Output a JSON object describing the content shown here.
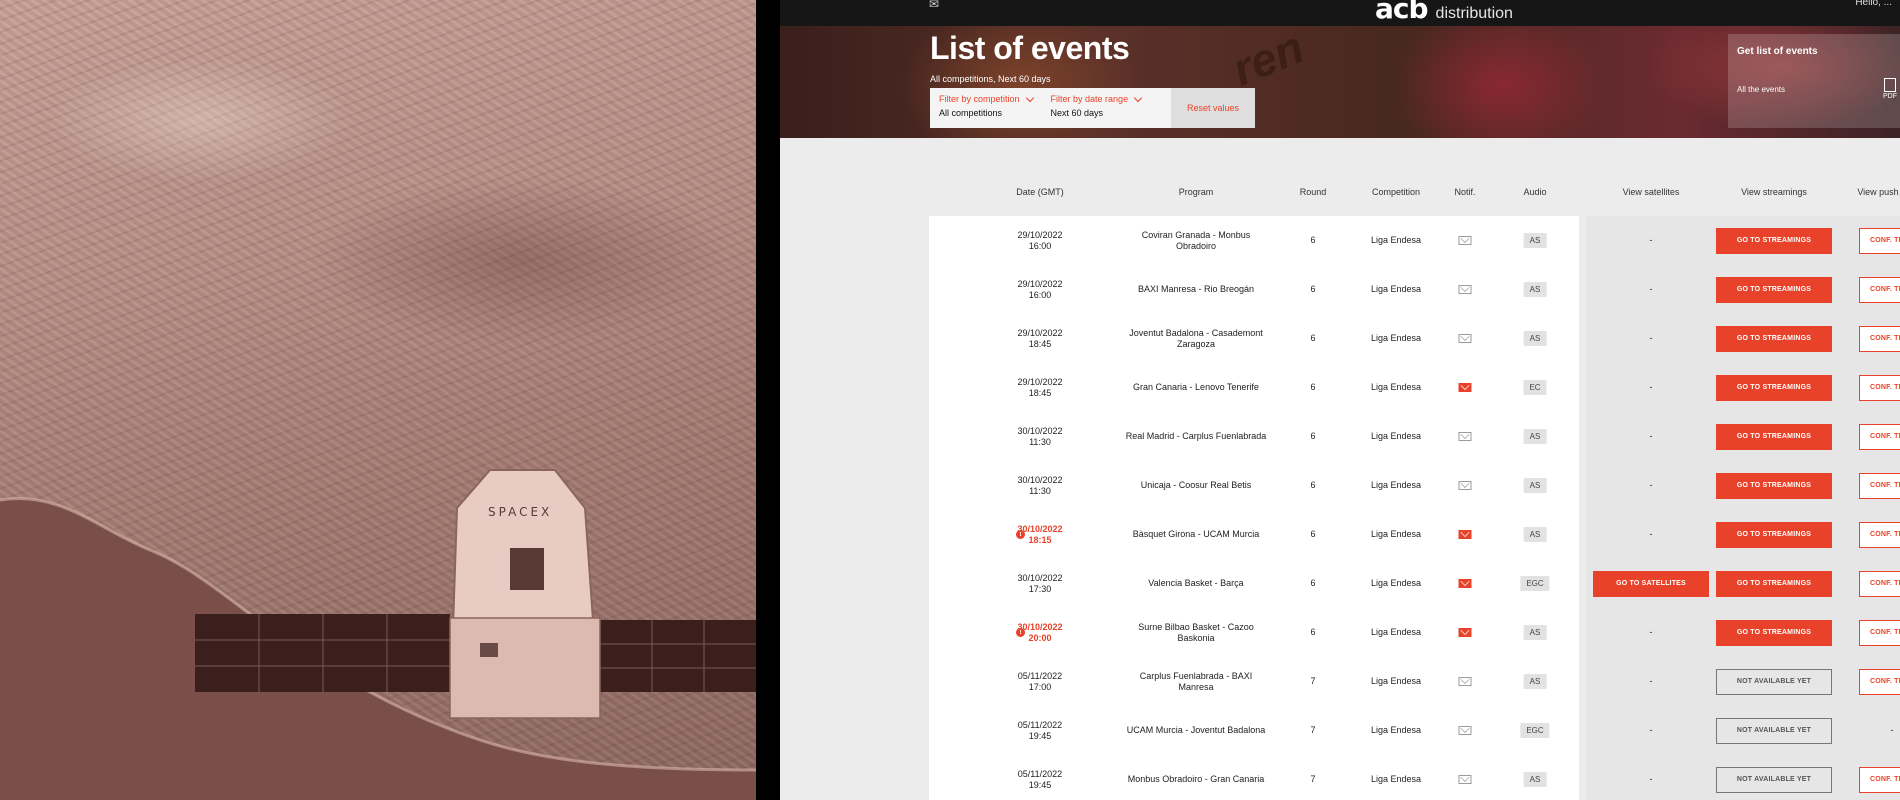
{
  "app": {
    "brand": "acb",
    "brand_sub": "distribution",
    "greeting": "Hello, ...",
    "title": "List of events",
    "subtitle": "All competitions,  Next 60 days",
    "filters": [
      {
        "label": "Filter by competition",
        "value": "All competitions"
      },
      {
        "label": "Filter by date range",
        "value": "Next 60 days"
      }
    ],
    "reset_label": "Reset values",
    "get_list": {
      "title": "Get list of events",
      "all_events": "All the events",
      "pdf": "PDF"
    },
    "columns": {
      "date": "Date (GMT)",
      "program": "Program",
      "round": "Round",
      "competition": "Competition",
      "notif": "Notif.",
      "audio": "Audio",
      "satellites": "View satellites",
      "streamings": "View streamings",
      "push": "View push"
    }
  },
  "rows": [
    {
      "date": "29/10/2022",
      "time": "16:00",
      "program": "Coviran Granada - Monbus Obradoiro",
      "round": "6",
      "competition": "Liga Endesa",
      "notif": false,
      "audio": "AS",
      "satellite": "-",
      "streaming": "GO TO STREAMINGS",
      "push": "CONF. TRAN"
    },
    {
      "date": "29/10/2022",
      "time": "16:00",
      "program": "BAXI Manresa - Rio Breogán",
      "round": "6",
      "competition": "Liga Endesa",
      "notif": false,
      "audio": "AS",
      "satellite": "-",
      "streaming": "GO TO STREAMINGS",
      "push": "CONF. TRAN"
    },
    {
      "date": "29/10/2022",
      "time": "18:45",
      "program": "Joventut Badalona - Casademont Zaragoza",
      "round": "6",
      "competition": "Liga Endesa",
      "notif": false,
      "audio": "AS",
      "satellite": "-",
      "streaming": "GO TO STREAMINGS",
      "push": "CONF. TRAN"
    },
    {
      "date": "29/10/2022",
      "time": "18:45",
      "program": "Gran Canaria - Lenovo Tenerife",
      "round": "6",
      "competition": "Liga Endesa",
      "notif": true,
      "audio": "EC",
      "satellite": "-",
      "streaming": "GO TO STREAMINGS",
      "push": "CONF. TRAN"
    },
    {
      "date": "30/10/2022",
      "time": "11:30",
      "program": "Real Madrid - Carplus Fuenlabrada",
      "round": "6",
      "competition": "Liga Endesa",
      "notif": false,
      "audio": "AS",
      "satellite": "-",
      "streaming": "GO TO STREAMINGS",
      "push": "CONF. TRAN"
    },
    {
      "date": "30/10/2022",
      "time": "11:30",
      "program": "Unicaja - Coosur Real Betis",
      "round": "6",
      "competition": "Liga Endesa",
      "notif": false,
      "audio": "AS",
      "satellite": "-",
      "streaming": "GO TO STREAMINGS",
      "push": "CONF. TRAN"
    },
    {
      "date": "30/10/2022",
      "time": "18:15",
      "program": "Bàsquet Girona - UCAM Murcia",
      "round": "6",
      "competition": "Liga Endesa",
      "notif": true,
      "audio": "AS",
      "satellite": "-",
      "streaming": "GO TO STREAMINGS",
      "push": "CONF. TRAN",
      "alert": true
    },
    {
      "date": "30/10/2022",
      "time": "17:30",
      "program": "Valencia Basket - Barça",
      "round": "6",
      "competition": "Liga Endesa",
      "notif": true,
      "audio": "EGC",
      "satellite": "GO TO SATELLITES",
      "streaming": "GO TO STREAMINGS",
      "push": "CONF. TRAN"
    },
    {
      "date": "30/10/2022",
      "time": "20:00",
      "program": "Surne Bilbao Basket - Cazoo Baskonia",
      "round": "6",
      "competition": "Liga Endesa",
      "notif": true,
      "audio": "AS",
      "satellite": "-",
      "streaming": "GO TO STREAMINGS",
      "push": "CONF. TRAN",
      "alert": true
    },
    {
      "date": "05/11/2022",
      "time": "17:00",
      "program": "Carplus Fuenlabrada - BAXI Manresa",
      "round": "7",
      "competition": "Liga Endesa",
      "notif": false,
      "audio": "AS",
      "satellite": "-",
      "streaming": "NOT AVAILABLE YET",
      "push": "CONF. TRAN"
    },
    {
      "date": "05/11/2022",
      "time": "19:45",
      "program": "UCAM Murcia - Joventut Badalona",
      "round": "7",
      "competition": "Liga Endesa",
      "notif": false,
      "audio": "EGC",
      "satellite": "-",
      "streaming": "NOT AVAILABLE YET",
      "push": "-"
    },
    {
      "date": "05/11/2022",
      "time": "19:45",
      "program": "Monbus Obradoiro - Gran Canaria",
      "round": "7",
      "competition": "Liga Endesa",
      "notif": false,
      "audio": "AS",
      "satellite": "-",
      "streaming": "NOT AVAILABLE YET",
      "push": "CONF. TRAN"
    }
  ],
  "photo": {
    "capsule_text": "SPACEX"
  },
  "colors": {
    "accent": "#e8432a",
    "topbar": "#161616",
    "filter_bg": "#f4f4f4"
  }
}
